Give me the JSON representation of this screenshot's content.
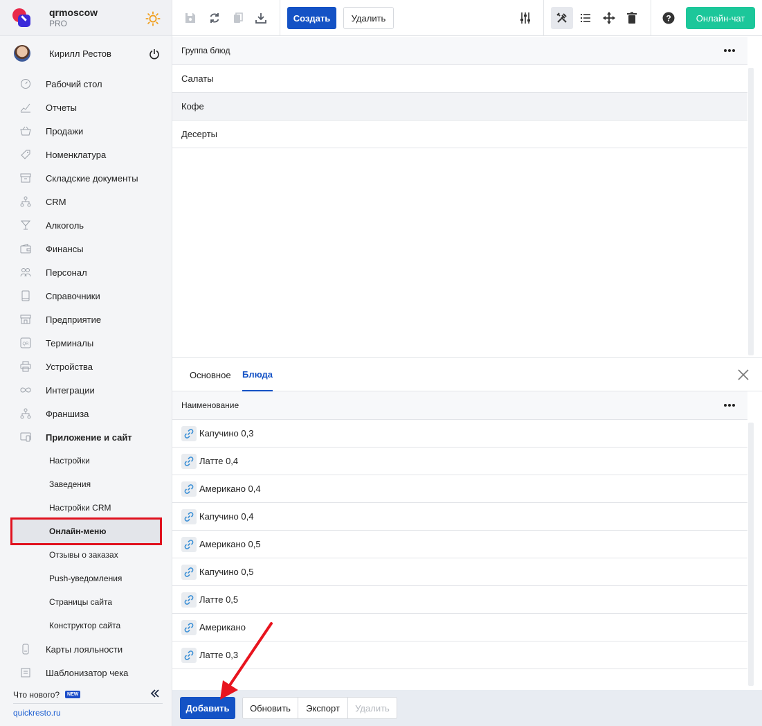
{
  "brand": {
    "name": "qrmoscow",
    "plan": "PRO"
  },
  "user": {
    "name": "Кирилл Рестов"
  },
  "nav": [
    {
      "label": "Рабочий стол",
      "icon": "dashboard-icon"
    },
    {
      "label": "Отчеты",
      "icon": "chart-icon"
    },
    {
      "label": "Продажи",
      "icon": "basket-icon"
    },
    {
      "label": "Номенклатура",
      "icon": "tag-icon"
    },
    {
      "label": "Складские документы",
      "icon": "archive-icon"
    },
    {
      "label": "CRM",
      "icon": "hierarchy-icon"
    },
    {
      "label": "Алкоголь",
      "icon": "cocktail-icon"
    },
    {
      "label": "Финансы",
      "icon": "wallet-icon"
    },
    {
      "label": "Персонал",
      "icon": "people-icon"
    },
    {
      "label": "Справочники",
      "icon": "book-icon"
    },
    {
      "label": "Предприятие",
      "icon": "store-icon"
    },
    {
      "label": "Терминалы",
      "icon": "qr-icon"
    },
    {
      "label": "Устройства",
      "icon": "printer-icon"
    },
    {
      "label": "Интеграции",
      "icon": "infinity-icon"
    },
    {
      "label": "Франшиза",
      "icon": "hierarchy-icon"
    },
    {
      "label": "Приложение и сайт",
      "icon": "app-icon"
    }
  ],
  "subnav": [
    "Настройки",
    "Заведения",
    "Настройки CRM",
    "Онлайн-меню",
    "Отзывы о заказах",
    "Push-уведомления",
    "Страницы сайта",
    "Конструктор сайта"
  ],
  "nav_after": [
    {
      "label": "Карты лояльности",
      "icon": "card-icon"
    },
    {
      "label": "Шаблонизатор чека",
      "icon": "receipt-icon"
    }
  ],
  "whats_new": {
    "label": "Что нового?",
    "badge": "NEW"
  },
  "site_link": "quickresto.ru",
  "toolbar": {
    "create": "Создать",
    "delete": "Удалить",
    "chat": "Онлайн-чат"
  },
  "groups": {
    "header": "Группа блюд",
    "rows": [
      "Салаты",
      "Кофе",
      "Десерты"
    ]
  },
  "tabs": {
    "main": "Основное",
    "dishes": "Блюда"
  },
  "dishes": {
    "header": "Наименование",
    "rows": [
      "Капучино 0,3",
      "Латте 0,4",
      "Американо 0,4",
      "Капучино 0,4",
      "Американо 0,5",
      "Капучино 0,5",
      "Латте 0,5",
      "Американо",
      "Латте 0,3"
    ]
  },
  "footer": {
    "add": "Добавить",
    "refresh": "Обновить",
    "export": "Экспорт",
    "delete": "Удалить"
  }
}
